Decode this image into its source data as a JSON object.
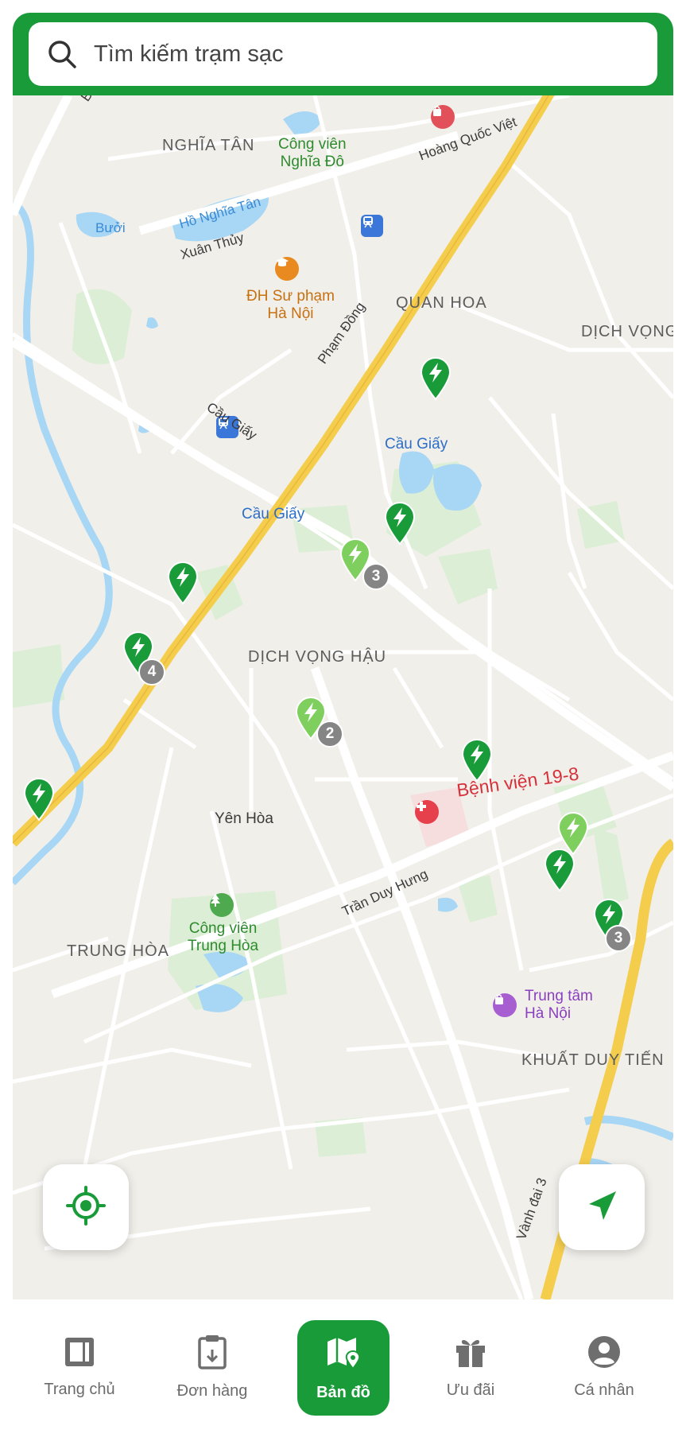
{
  "search": {
    "placeholder": "Tìm kiếm trạm sạc"
  },
  "map": {
    "districts": [
      "NGHĨA TÂN",
      "QUAN HOA",
      "DỊCH VỌNG",
      "DỊCH VỌNG HẬU",
      "Yên Hòa",
      "TRUNG HÒA",
      "KHUẤT DUY TIẾN"
    ],
    "streets": [
      "Bưởi Dư",
      "Hoàng Quốc Việt",
      "Xuân Thủy",
      "Phạm Đồng",
      "Cầu Giấy",
      "Trần Duy Hưng",
      "Vành đai 3"
    ],
    "water": [
      "Hồ Nghĩa Tân",
      "Bưởi"
    ],
    "pois": {
      "cong_vien_nghia_do": [
        "Công viên",
        "Nghĩa Đô"
      ],
      "dh_su_pham": [
        "ĐH Sư phạm",
        "Hà Nội"
      ],
      "cau_giay_metro_1": "Cầu Giấy",
      "cau_giay_metro_2": "Cầu Giấy",
      "benh_vien": "Bệnh viện 19-8",
      "cong_vien_trung_hoa": [
        "Công viên",
        "Trung Hòa"
      ],
      "trung_tam": [
        "Trung tâm",
        "Hà Nội"
      ]
    },
    "cluster_counts": [
      "3",
      "4",
      "2",
      "3"
    ]
  },
  "colors": {
    "brand": "#1a9b3a",
    "pin_dark": "#1a9b3a",
    "pin_light": "#7fcf5f",
    "badge": "#858585"
  },
  "nav": {
    "items": [
      {
        "label": "Trang chủ",
        "icon": "home-panel-icon"
      },
      {
        "label": "Đơn hàng",
        "icon": "clipboard-icon"
      },
      {
        "label": "Bản đồ",
        "icon": "map-pin-icon"
      },
      {
        "label": "Ưu đãi",
        "icon": "gift-icon"
      },
      {
        "label": "Cá nhân",
        "icon": "user-icon"
      }
    ],
    "active": "Bản đồ"
  }
}
